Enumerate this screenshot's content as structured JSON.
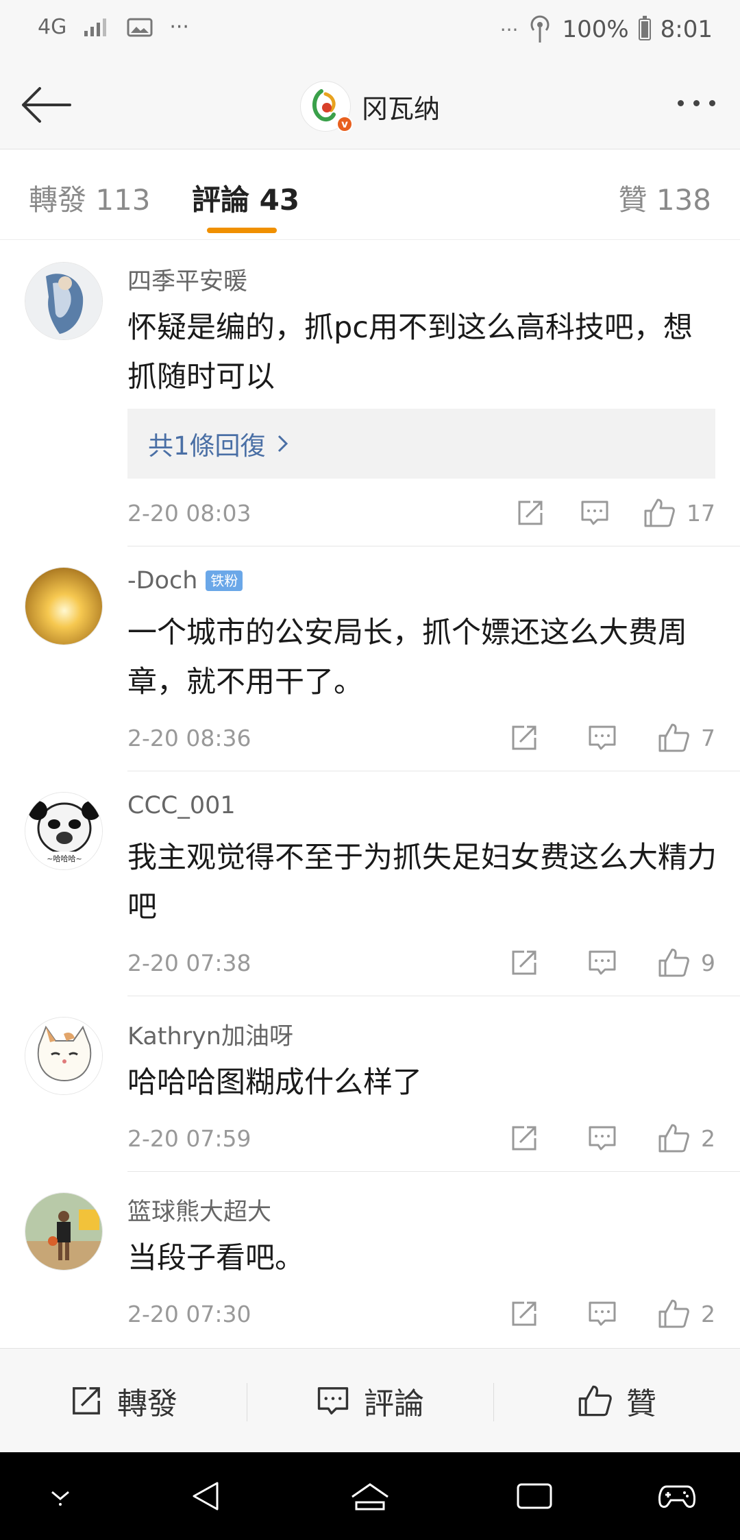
{
  "status_bar": {
    "network": "4G",
    "battery": "100%",
    "time": "8:01"
  },
  "nav": {
    "title": "冈瓦纳"
  },
  "tabs": [
    {
      "label": "轉發 113"
    },
    {
      "label": "評論 43"
    },
    {
      "label": "贊 138"
    }
  ],
  "comments": [
    {
      "username": "四季平安暖",
      "text": "怀疑是编的，抓pc用不到这么高科技吧，想抓随时可以",
      "replies_label": "共1條回復",
      "time": "2-20 08:03",
      "likes": "17"
    },
    {
      "username": "-Doch",
      "badge": "铁粉",
      "text": "一个城市的公安局长，抓个嫖还这么大费周章，就不用干了。",
      "time": "2-20 08:36",
      "likes": "7"
    },
    {
      "username": "CCC_001",
      "text": "我主观觉得不至于为抓失足妇女费这么大精力吧",
      "time": "2-20 07:38",
      "likes": "9"
    },
    {
      "username": "Kathryn加油呀",
      "text": "哈哈哈图糊成什么样了",
      "time": "2-20 07:59",
      "likes": "2"
    },
    {
      "username": "篮球熊大超大",
      "text": "当段子看吧。",
      "time": "2-20 07:30",
      "likes": "2"
    }
  ],
  "bottom_bar": {
    "repost": "轉發",
    "comment": "評論",
    "like": "贊"
  },
  "icons": {
    "back": "back-arrow-icon",
    "more": "more-dots-icon",
    "share": "share-icon",
    "comment": "comment-icon",
    "like": "thumbs-up-icon"
  },
  "colors": {
    "accent": "#f09000",
    "link": "#4a6fa5"
  }
}
